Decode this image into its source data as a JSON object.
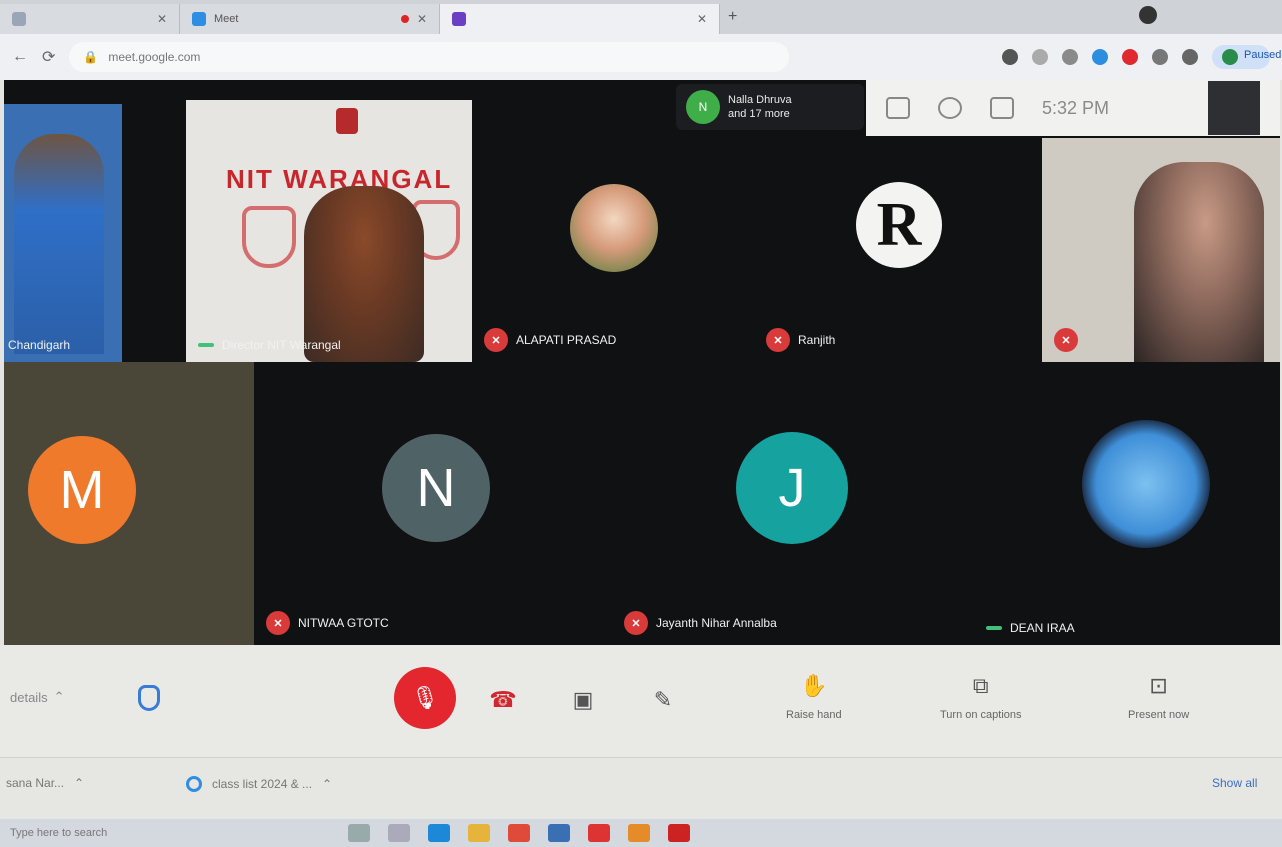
{
  "browser": {
    "tabs": [
      {
        "label": "",
        "fav_color": "#9aa6b8"
      },
      {
        "label": "Meet",
        "fav_color": "#2f8de4"
      },
      {
        "label": "",
        "fav_color": "#6a3fc3"
      }
    ],
    "new_tab_glyph": "+",
    "url": "meet.google.com",
    "paused_label": "Paused"
  },
  "meeting": {
    "clock": "5:32 PM",
    "speaker_pill": {
      "initial": "N",
      "line1": "Nalla Dhruva",
      "line2": "and 17 more"
    },
    "tiles_top": [
      {
        "name": "Chandigarh",
        "status": "speaking"
      },
      {
        "name": "Director NIT Warangal",
        "status": "speaking",
        "banner": "NIT WARANGAL"
      },
      {
        "name": "ALAPATI PRASAD",
        "status": "muted"
      },
      {
        "name": "Ranjith",
        "status": "muted",
        "initial": "R"
      },
      {
        "name": "",
        "status": "muted"
      }
    ],
    "tiles_bottom": [
      {
        "name": "",
        "initial": "M",
        "color": "#f07a2b"
      },
      {
        "name": "NITWAA GTOTC",
        "initial": "N",
        "color": "#4f6266",
        "status": "muted"
      },
      {
        "name": "Jayanth Nihar Annalba",
        "initial": "J",
        "color": "#16a3a0",
        "status": "muted"
      },
      {
        "name": "DEAN IRAA",
        "status": "speaking"
      }
    ]
  },
  "controls": {
    "details_label": "details",
    "raise_hand": "Raise hand",
    "captions": "Turn on captions",
    "present": "Present now"
  },
  "downloads": {
    "item1": "sana Nar...",
    "item2": "class list 2024 & ...",
    "show_all": "Show all"
  },
  "taskbar": {
    "search": "Type here to search"
  }
}
